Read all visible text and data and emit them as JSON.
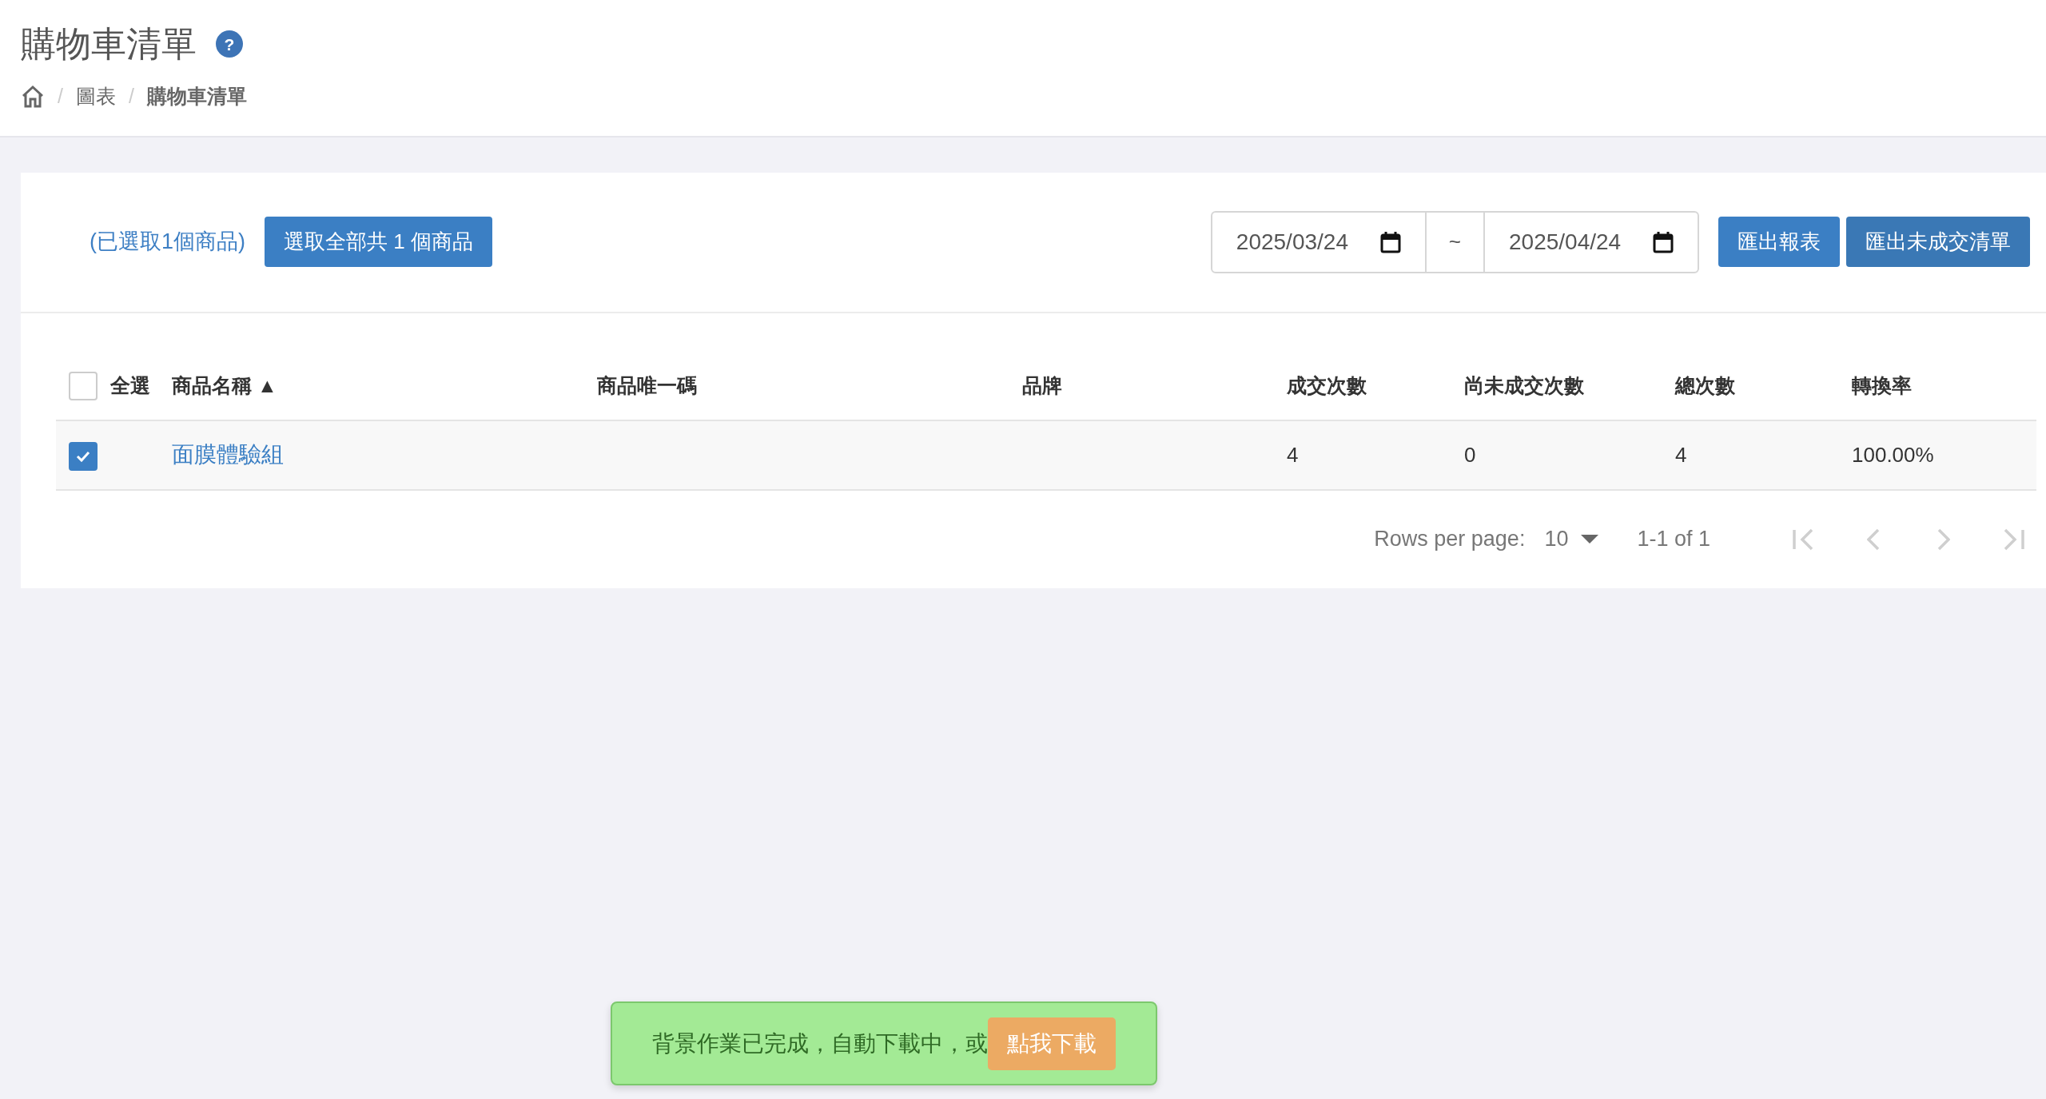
{
  "header": {
    "title": "購物車清單",
    "help": "?",
    "breadcrumb": [
      {
        "separator": "/",
        "label": "圖表",
        "current": false
      },
      {
        "separator": "/",
        "label": "購物車清單",
        "current": true
      }
    ]
  },
  "toolbar": {
    "selection_note": "(已選取1個商品)",
    "select_all_button": "選取全部共 1 個商品",
    "date_from": "2025/03/24",
    "date_separator": "~",
    "date_to": "2025/04/24",
    "buttons": [
      "匯出報表",
      "匯出未成交清單"
    ]
  },
  "table": {
    "select_all": {
      "label": "全選",
      "checked": false
    },
    "columns": [
      {
        "label": "商品名稱",
        "sort": "▲"
      },
      {
        "label": "商品唯一碼"
      },
      {
        "label": "品牌"
      },
      {
        "label": "成交次數"
      },
      {
        "label": "尚未成交次數"
      },
      {
        "label": "總次數"
      },
      {
        "label": "轉換率"
      }
    ],
    "rows": [
      {
        "checked": true,
        "cells": [
          "面膜體驗組",
          "",
          "",
          "4",
          "0",
          "4",
          "100.00%"
        ]
      }
    ]
  },
  "pagination": {
    "rows_per_page_label": "Rows per page:",
    "rows_per_page": "10",
    "range": "1-1 of 1",
    "buttons": [
      {
        "kind": "first",
        "disabled": true
      },
      {
        "kind": "prev",
        "disabled": true
      },
      {
        "kind": "next",
        "disabled": true
      },
      {
        "kind": "last",
        "disabled": true
      }
    ]
  },
  "toast": {
    "message": "背景作業已完成，自動下載中，或",
    "button": "點我下載"
  }
}
